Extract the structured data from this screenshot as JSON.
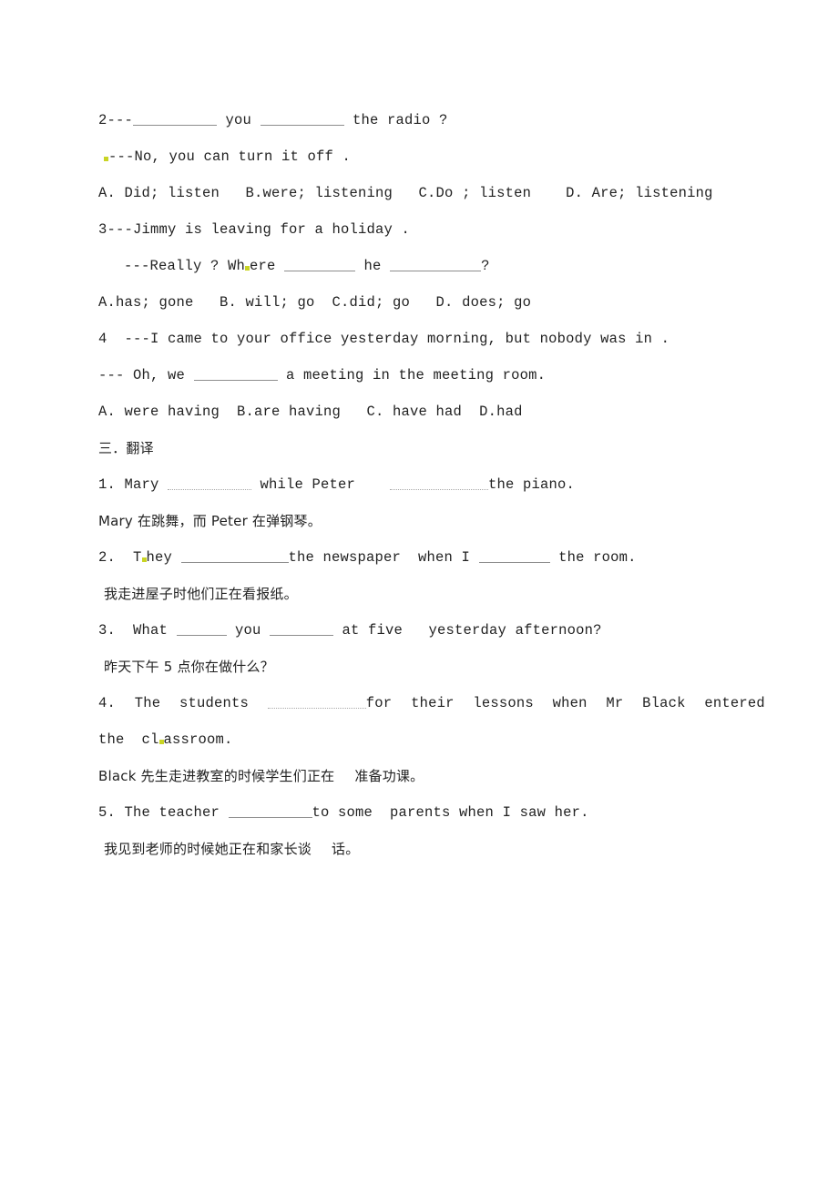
{
  "document": {
    "type": "english-grammar-worksheet",
    "page_background": "#ffffff",
    "text_color": "#222222",
    "mark_color": "#c9d424"
  },
  "questions": {
    "q2": {
      "stem_prefix": "2---",
      "stem_mid": " you ",
      "stem_suffix": " the radio ?",
      "reply": "---No, you can turn it off .",
      "options": "A. Did; listen   B.were; listening   C.Do ; listen    D. Are; listening"
    },
    "q3": {
      "stem": "3---Jimmy is leaving for a holiday .",
      "reply_prefix": "---Really ? Wh",
      "reply_mid": "ere ",
      "reply_mid2": " he ",
      "reply_suffix": "?",
      "options": "A.has; gone   B. will; go  C.did; go   D. does; go"
    },
    "q4": {
      "stem": "4  ---I came to your office yesterday morning, but nobody was in .",
      "reply_prefix": "--- Oh, we ",
      "reply_suffix": " a meeting in the meeting room.",
      "options": "A. were having  B.are having   C. have had  D.had"
    }
  },
  "section_three": {
    "heading": "三．翻译",
    "items": [
      {
        "id": "t1",
        "en_prefix": "1. Mary ",
        "en_mid": " while Peter    ",
        "en_suffix": "the piano.",
        "cn": "Mary 在跳舞，而 Peter 在弹钢琴。"
      },
      {
        "id": "t2",
        "en_prefix": "2.  T",
        "en_after_mark": "hey ",
        "en_mid": "the newspaper  when I ",
        "en_suffix": " the room.",
        "cn": "我走进屋子时他们正在看报纸。"
      },
      {
        "id": "t3",
        "en_prefix": "3.  What ",
        "en_mid": " you ",
        "en_suffix": " at five   yesterday afternoon?",
        "cn": "昨天下午 5 点你在做什么？"
      },
      {
        "id": "t4",
        "en_w1": "4.",
        "en_w2": "The",
        "en_w3": "students",
        "en_w4": "for",
        "en_w5": "their",
        "en_w6": "lessons",
        "en_w7": "when",
        "en_w8": "Mr",
        "en_w9": "Black",
        "en_w10": "entered",
        "en_line2_prefix": "the  cl",
        "en_line2_suffix": "assroom.",
        "cn": "Black 先生走进教室的时候学生们正在",
        "cn_tail": "准备功课。"
      },
      {
        "id": "t5",
        "en_prefix": "5. The teacher ",
        "en_suffix": "to some  parents when I saw her.",
        "cn": "我见到老师的时候她正在和家长谈",
        "cn_tail": "话。"
      }
    ]
  }
}
